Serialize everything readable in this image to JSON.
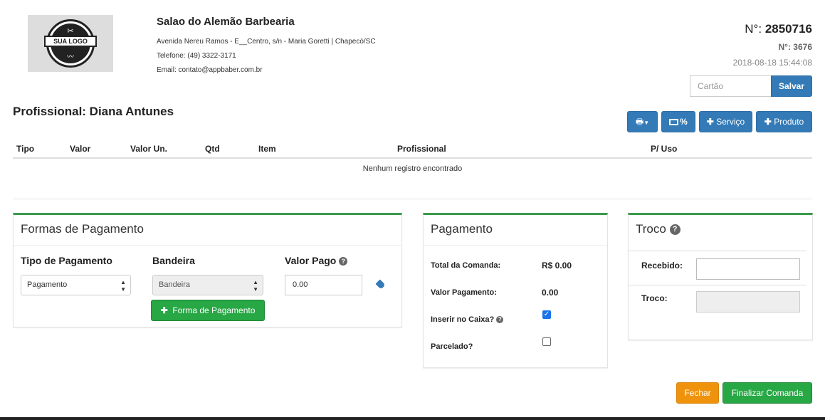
{
  "header": {
    "logo_text": "SUA LOGO",
    "company_name": "Salao do Alemão Barbearia",
    "address": "Avenida Nereu Ramos - E__Centro, s/n - Maria Goretti | Chapecó/SC",
    "phone": "Telefone: (49) 3322-3171",
    "email": "Email: contato@appbaber.com.br",
    "number_label": "N°:",
    "number_value": "2850716",
    "sub_number": "N°: 3676",
    "datetime": "2018-08-18 15:44:08"
  },
  "card": {
    "placeholder": "Cartão",
    "save_label": "Salvar"
  },
  "professional": {
    "title": "Profissional: Diana Antunes"
  },
  "toolbar": {
    "print_icon": "print-icon",
    "discount_label": "%",
    "service_label": "Serviço",
    "product_label": "Produto"
  },
  "table": {
    "columns": [
      "Tipo",
      "Valor",
      "Valor Un.",
      "Qtd",
      "Item",
      "Profissional",
      "P/ Uso"
    ],
    "empty_message": "Nenhum registro encontrado"
  },
  "payment_methods": {
    "title": "Formas de Pagamento",
    "type_label": "Tipo de Pagamento",
    "brand_label": "Bandeira",
    "paid_label": "Valor Pago",
    "type_selected": "Pagamento",
    "brand_selected": "Bandeira",
    "paid_value": "0.00",
    "add_label": "Forma de Pagamento"
  },
  "payment": {
    "title": "Pagamento",
    "total_label": "Total da Comanda:",
    "total_value": "R$ 0.00",
    "paid_label": "Valor Pagamento:",
    "paid_value": "0.00",
    "cash_label": "Inserir no Caixa?",
    "cash_checked": true,
    "installment_label": "Parcelado?",
    "installment_checked": false
  },
  "change": {
    "title": "Troco",
    "received_label": "Recebido:",
    "change_label": "Troco:"
  },
  "footer": {
    "close_label": "Fechar",
    "finish_label": "Finalizar Comanda"
  },
  "colors": {
    "primary": "#337ab7",
    "success": "#28a745",
    "warning": "#f0930c",
    "panel_accent": "#3c9a4c"
  }
}
